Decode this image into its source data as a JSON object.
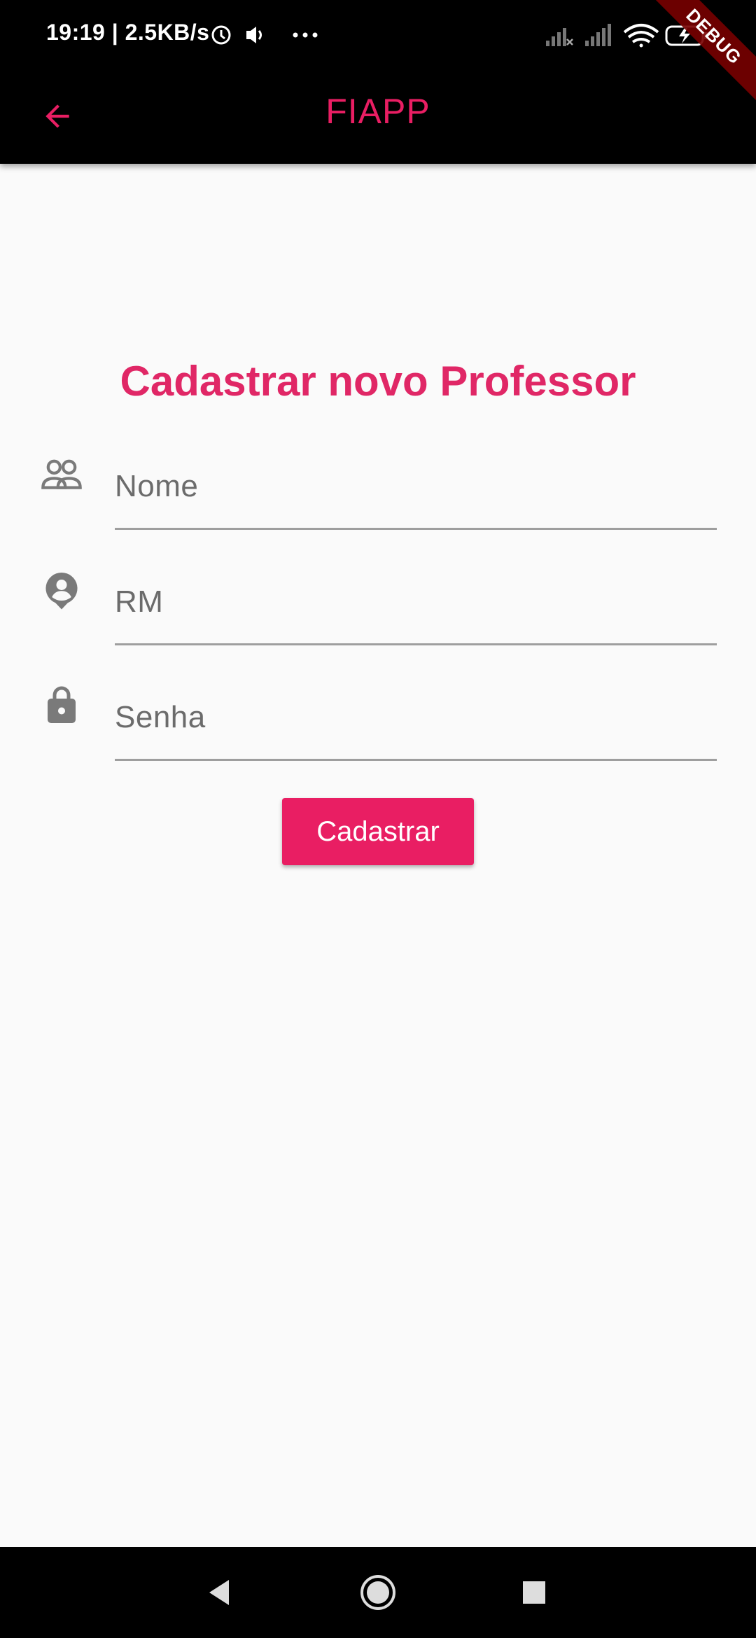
{
  "status_bar": {
    "time_and_speed": "19:19 | 2.5KB/s",
    "icons": [
      "alarm-icon",
      "volume-icon",
      "more-dots-icon",
      "signal-x-icon",
      "signal-icon",
      "wifi-icon",
      "battery-charging-icon"
    ],
    "debug_label": "DEBUG"
  },
  "app_bar": {
    "title": "FIAPP",
    "accent_color": "#e91e63"
  },
  "form": {
    "title": "Cadastrar novo Professor",
    "fields": [
      {
        "icon": "people-icon",
        "placeholder": "Nome"
      },
      {
        "icon": "account-pin-icon",
        "placeholder": "RM"
      },
      {
        "icon": "lock-icon",
        "placeholder": "Senha"
      }
    ],
    "submit_label": "Cadastrar"
  },
  "nav_bar": {
    "buttons": [
      "back-triangle-icon",
      "home-circle-icon",
      "recents-square-icon"
    ]
  }
}
